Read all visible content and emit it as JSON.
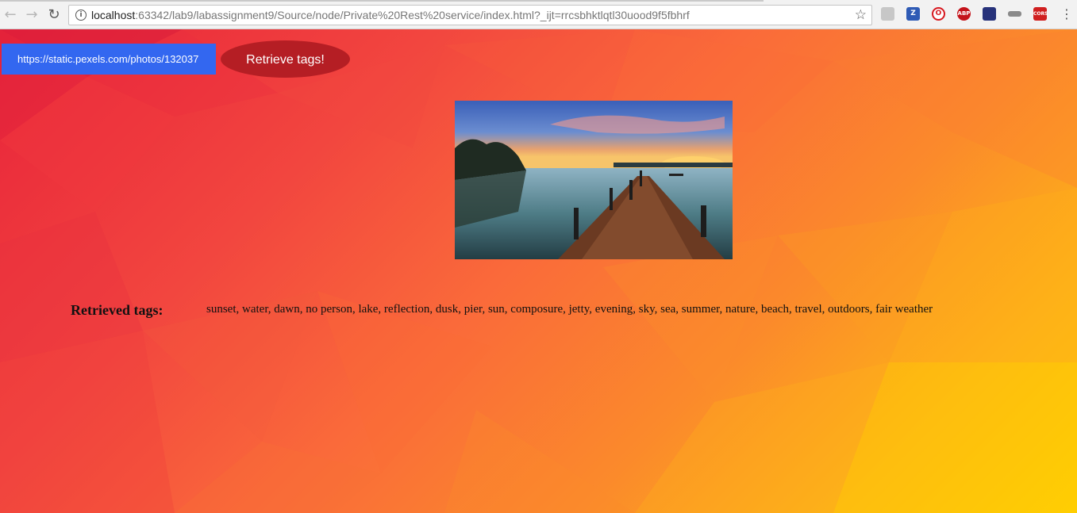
{
  "browser": {
    "url_host": "localhost",
    "url_rest": ":63342/lab9/labassignment9/Source/node/Private%20Rest%20service/index.html?_ijt=rrcsbhktlqtl30uood9f5fbhrf",
    "back_icon": "←",
    "forward_icon": "→",
    "reload_icon": "↻",
    "info_icon": "i",
    "star_icon": "☆",
    "menu_icon": "⋮",
    "extensions": [
      {
        "name": "pdf-extension-icon",
        "label": "",
        "color": "#c0c0c0"
      },
      {
        "name": "zotero-extension-icon",
        "label": "Z",
        "color": "#2f5bb5"
      },
      {
        "name": "opera-extension-icon",
        "label": "O",
        "color": "#d71920"
      },
      {
        "name": "adblock-extension-icon",
        "label": "ABP",
        "color": "#c4131a"
      },
      {
        "name": "wappalyzer-extension-icon",
        "label": "",
        "color": "#27327a"
      },
      {
        "name": "gray-extension-icon",
        "label": "",
        "color": "#888888"
      },
      {
        "name": "cors-extension-icon",
        "label": "CORS",
        "color": "#d01f1f"
      }
    ]
  },
  "page": {
    "url_input_value": "https://static.pexels.com/photos/132037",
    "retrieve_button_label": "Retrieve tags!",
    "tags_label": "Retrieved tags:",
    "tags_text": "sunset, water, dawn, no person, lake, reflection, dusk, pier, sun, composure, jetty, evening, sky, sea, summer, nature, beach, travel, outdoors, fair weather",
    "colors": {
      "input_bg": "#3367f0",
      "button_bg": "#b51e24"
    }
  }
}
